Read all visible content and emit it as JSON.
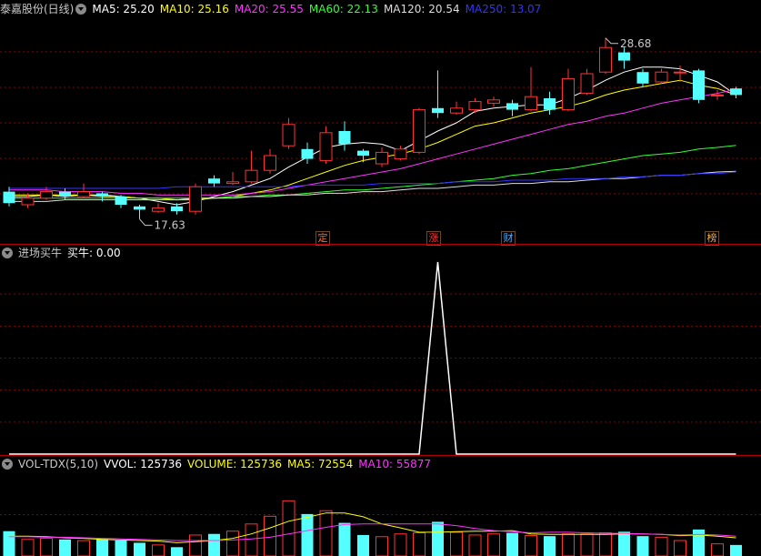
{
  "price_panel": {
    "title": "泰嘉股份(日线)",
    "ma": [
      {
        "label": "MA5: 25.20",
        "color": "#ffffff"
      },
      {
        "label": "MA10: 25.16",
        "color": "#ffff00"
      },
      {
        "label": "MA20: 25.55",
        "color": "#ff33ff"
      },
      {
        "label": "MA60: 22.13",
        "color": "#33ff33"
      },
      {
        "label": "MA120: 20.54",
        "color": "#dddddd"
      },
      {
        "label": "MA250: 13.07",
        "color": "#3333ff"
      }
    ],
    "high_label": "28.68",
    "low_label": "17.63",
    "events": [
      "定",
      "涨",
      "财",
      "榜"
    ]
  },
  "indicator_panel": {
    "name": "进场买牛",
    "value_label": "买牛: 0.00"
  },
  "volume_panel": {
    "name": "VOL-TDX(5,10)",
    "vvol_label": "VVOL: 125736",
    "volume_label": "VOLUME: 125736",
    "ma5_label": "MA5: 72554",
    "ma10_label": "MA10: 55877"
  },
  "colors": {
    "up": "#ff3232",
    "down": "#54ffff",
    "grid": "#8b0000",
    "signal": "#ffffff"
  },
  "chart_data": [
    {
      "type": "candlestick",
      "ylim": [
        17,
        30
      ],
      "candles": [
        {
          "o": 19.3,
          "c": 18.6,
          "h": 19.6,
          "l": 18.4
        },
        {
          "o": 18.5,
          "c": 18.9,
          "h": 19.2,
          "l": 18.3
        },
        {
          "o": 18.9,
          "c": 19.3,
          "h": 19.6,
          "l": 18.8
        },
        {
          "o": 19.3,
          "c": 19.0,
          "h": 19.5,
          "l": 18.8
        },
        {
          "o": 19.0,
          "c": 19.3,
          "h": 19.8,
          "l": 18.9
        },
        {
          "o": 19.2,
          "c": 19.0,
          "h": 19.3,
          "l": 18.7
        },
        {
          "o": 19.0,
          "c": 18.5,
          "h": 19.1,
          "l": 18.3
        },
        {
          "o": 18.4,
          "c": 18.2,
          "h": 18.5,
          "l": 17.63
        },
        {
          "o": 18.1,
          "c": 18.3,
          "h": 18.6,
          "l": 18.0
        },
        {
          "o": 18.4,
          "c": 18.1,
          "h": 18.6,
          "l": 17.9
        },
        {
          "o": 18.1,
          "c": 19.6,
          "h": 19.8,
          "l": 17.9
        },
        {
          "o": 20.1,
          "c": 19.8,
          "h": 20.3,
          "l": 19.6
        },
        {
          "o": 19.8,
          "c": 19.9,
          "h": 20.5,
          "l": 19.7
        },
        {
          "o": 19.9,
          "c": 20.6,
          "h": 21.8,
          "l": 19.8
        },
        {
          "o": 20.6,
          "c": 21.5,
          "h": 21.9,
          "l": 20.4
        },
        {
          "o": 22.1,
          "c": 23.4,
          "h": 23.8,
          "l": 21.9
        },
        {
          "o": 21.9,
          "c": 21.3,
          "h": 22.3,
          "l": 21.0
        },
        {
          "o": 21.2,
          "c": 22.9,
          "h": 23.3,
          "l": 21.0
        },
        {
          "o": 23.0,
          "c": 22.2,
          "h": 23.6,
          "l": 21.8
        },
        {
          "o": 21.8,
          "c": 21.5,
          "h": 21.9,
          "l": 21.1
        },
        {
          "o": 21.0,
          "c": 21.7,
          "h": 22.0,
          "l": 20.8
        },
        {
          "o": 21.3,
          "c": 21.9,
          "h": 22.1,
          "l": 21.2
        },
        {
          "o": 21.7,
          "c": 24.3,
          "h": 24.4,
          "l": 21.6
        },
        {
          "o": 24.4,
          "c": 24.1,
          "h": 26.7,
          "l": 23.8
        },
        {
          "o": 24.1,
          "c": 24.4,
          "h": 24.8,
          "l": 24.0
        },
        {
          "o": 24.3,
          "c": 24.8,
          "h": 25.0,
          "l": 24.1
        },
        {
          "o": 24.7,
          "c": 24.9,
          "h": 25.1,
          "l": 24.5
        },
        {
          "o": 24.7,
          "c": 24.3,
          "h": 24.9,
          "l": 23.9
        },
        {
          "o": 24.3,
          "c": 25.1,
          "h": 26.9,
          "l": 24.2
        },
        {
          "o": 25.0,
          "c": 24.3,
          "h": 25.4,
          "l": 24.0
        },
        {
          "o": 24.3,
          "c": 26.2,
          "h": 26.8,
          "l": 24.2
        },
        {
          "o": 25.3,
          "c": 26.5,
          "h": 26.8,
          "l": 25.2
        },
        {
          "o": 26.6,
          "c": 28.1,
          "h": 28.68,
          "l": 26.5
        },
        {
          "o": 27.8,
          "c": 27.3,
          "h": 28.1,
          "l": 26.8
        },
        {
          "o": 26.6,
          "c": 25.9,
          "h": 26.8,
          "l": 25.7
        },
        {
          "o": 26.0,
          "c": 26.6,
          "h": 26.8,
          "l": 25.9
        },
        {
          "o": 26.6,
          "c": 26.6,
          "h": 27.0,
          "l": 26.0
        },
        {
          "o": 26.7,
          "c": 24.9,
          "h": 26.8,
          "l": 24.7
        },
        {
          "o": 25.2,
          "c": 25.2,
          "h": 25.5,
          "l": 24.9
        },
        {
          "o": 25.6,
          "c": 25.2,
          "h": 25.7,
          "l": 25.0
        }
      ],
      "ma_series": {
        "MA5": [
          19.0,
          19.0,
          19.1,
          19.0,
          19.1,
          19.1,
          19.0,
          18.9,
          18.7,
          18.5,
          18.7,
          19.0,
          19.3,
          19.7,
          20.1,
          20.8,
          21.4,
          22.0,
          22.2,
          22.3,
          22.2,
          21.8,
          22.4,
          23.0,
          23.5,
          24.2,
          24.4,
          24.5,
          24.6,
          24.6,
          25.0,
          25.5,
          26.1,
          26.6,
          26.9,
          26.9,
          26.8,
          26.4,
          26.0,
          25.2
        ],
        "MA10": [
          19.1,
          19.1,
          19.1,
          19.1,
          19.1,
          19.0,
          19.0,
          18.9,
          18.9,
          18.8,
          18.8,
          18.9,
          19.0,
          19.2,
          19.4,
          19.7,
          20.1,
          20.5,
          20.9,
          21.2,
          21.4,
          21.6,
          21.9,
          22.3,
          22.8,
          23.3,
          23.5,
          23.8,
          24.1,
          24.3,
          24.5,
          24.8,
          25.2,
          25.5,
          25.7,
          25.9,
          26.1,
          25.8,
          25.6,
          25.2
        ],
        "MA20": [
          19.4,
          19.4,
          19.4,
          19.3,
          19.3,
          19.3,
          19.2,
          19.2,
          19.1,
          19.1,
          19.1,
          19.1,
          19.1,
          19.2,
          19.3,
          19.5,
          19.7,
          19.9,
          20.1,
          20.3,
          20.5,
          20.7,
          21.0,
          21.3,
          21.6,
          21.9,
          22.2,
          22.5,
          22.8,
          23.1,
          23.4,
          23.6,
          23.9,
          24.1,
          24.4,
          24.7,
          24.9,
          25.1,
          25.3,
          25.55
        ],
        "MA60": [
          18.9,
          18.9,
          18.9,
          18.9,
          18.9,
          18.9,
          18.9,
          18.9,
          18.9,
          18.9,
          18.9,
          18.9,
          19.0,
          19.0,
          19.1,
          19.1,
          19.2,
          19.3,
          19.4,
          19.4,
          19.5,
          19.6,
          19.7,
          19.8,
          19.9,
          20.0,
          20.1,
          20.3,
          20.4,
          20.6,
          20.7,
          20.9,
          21.1,
          21.3,
          21.5,
          21.6,
          21.7,
          21.9,
          22.0,
          22.13
        ],
        "MA120": [
          18.7,
          18.7,
          18.7,
          18.8,
          18.8,
          18.8,
          18.8,
          18.8,
          18.8,
          18.8,
          18.9,
          18.9,
          18.9,
          19.0,
          19.0,
          19.1,
          19.1,
          19.2,
          19.2,
          19.3,
          19.3,
          19.4,
          19.5,
          19.5,
          19.6,
          19.7,
          19.7,
          19.8,
          19.8,
          19.9,
          19.9,
          20.0,
          20.1,
          20.1,
          20.2,
          20.3,
          20.3,
          20.4,
          20.5,
          20.54
        ],
        "MA250": [
          19.5,
          19.5,
          19.5,
          19.5,
          19.5,
          19.5,
          19.5,
          19.5,
          19.5,
          19.6,
          19.6,
          19.6,
          19.6,
          19.6,
          19.6,
          19.6,
          19.7,
          19.7,
          19.7,
          19.7,
          19.8,
          19.8,
          19.8,
          19.8,
          19.9,
          19.9,
          19.9,
          20.0,
          20.0,
          20.0,
          20.1,
          20.1,
          20.1,
          20.2,
          20.2,
          20.3,
          20.3,
          20.4,
          20.4,
          20.5
        ]
      }
    },
    {
      "type": "line",
      "name": "买牛",
      "values": [
        0,
        0,
        0,
        0,
        0,
        0,
        0,
        0,
        0,
        0,
        0,
        0,
        0,
        0,
        0,
        0,
        0,
        0,
        0,
        0,
        0,
        0,
        0,
        1,
        0,
        0,
        0,
        0,
        0,
        0,
        0,
        0,
        0,
        0,
        0,
        0,
        0,
        0,
        0,
        0
      ],
      "ylim": [
        0,
        1
      ]
    },
    {
      "type": "bar",
      "ylim": [
        0,
        150000
      ],
      "volume": [
        45000,
        30000,
        32000,
        30000,
        28000,
        31000,
        28000,
        24000,
        20000,
        16000,
        38000,
        40000,
        45000,
        58000,
        72000,
        100000,
        76000,
        82000,
        60000,
        38000,
        35000,
        40000,
        42000,
        62000,
        43000,
        38000,
        40000,
        42000,
        37000,
        36000,
        40000,
        40000,
        42000,
        44000,
        36000,
        34000,
        28000,
        48000,
        22000,
        20000
      ],
      "up": [
        false,
        true,
        true,
        false,
        true,
        false,
        false,
        false,
        true,
        false,
        true,
        false,
        true,
        true,
        true,
        true,
        false,
        true,
        false,
        false,
        true,
        true,
        true,
        false,
        true,
        true,
        true,
        false,
        true,
        false,
        true,
        true,
        true,
        false,
        false,
        true,
        true,
        false,
        true,
        false
      ],
      "ma5": [
        36000,
        36000,
        35000,
        33000,
        32000,
        30000,
        29000,
        28000,
        27000,
        24000,
        26000,
        28000,
        32000,
        40000,
        51000,
        63000,
        70000,
        78000,
        78000,
        71000,
        58000,
        51000,
        43000,
        43000,
        44000,
        45000,
        45000,
        46000,
        40000,
        39000,
        39000,
        39000,
        39000,
        40000,
        40000,
        39000,
        37000,
        38000,
        36000,
        33000
      ],
      "ma10": [
        35000,
        35000,
        34000,
        34000,
        33000,
        32000,
        31000,
        30000,
        29000,
        28000,
        28000,
        28000,
        29000,
        31000,
        34000,
        40000,
        46000,
        52000,
        57000,
        58000,
        58000,
        58000,
        58000,
        58000,
        55000,
        50000,
        46000,
        44000,
        42000,
        43000,
        43000,
        42000,
        41000,
        41000,
        40000,
        39000,
        38000,
        39000,
        38000,
        36000
      ]
    }
  ]
}
